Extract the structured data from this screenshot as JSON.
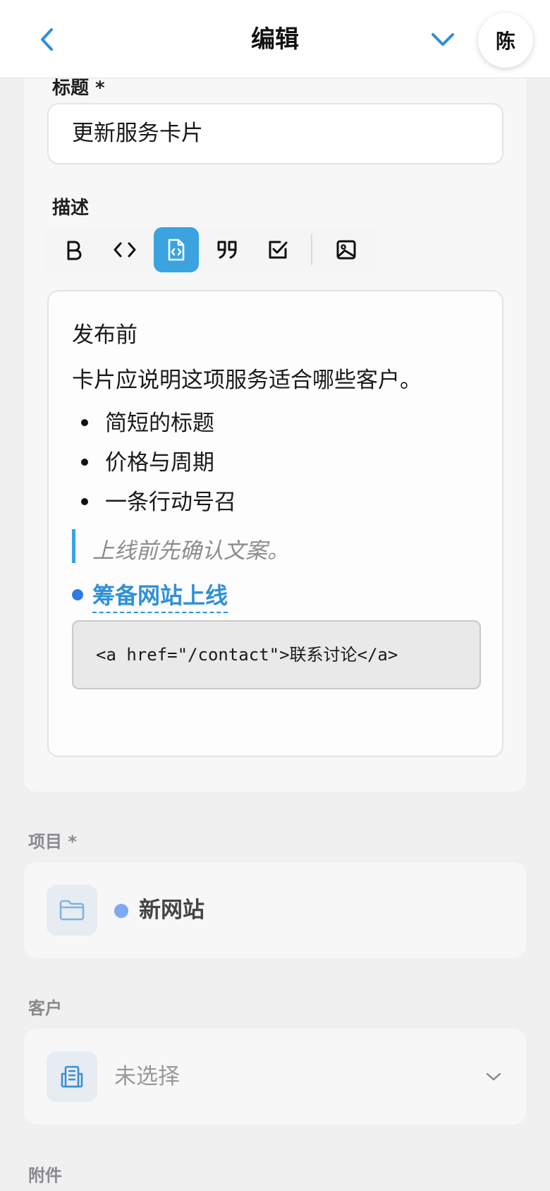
{
  "header": {
    "title": "编辑",
    "avatar_initial": "陈"
  },
  "form": {
    "title_label": "标题 *",
    "title_value": "更新服务卡片",
    "description_label": "描述",
    "toolbar": [
      "bold-icon",
      "code-icon",
      "code-block-icon",
      "quote-icon",
      "checkbox-icon",
      "image-icon"
    ],
    "editor": {
      "heading": "发布前",
      "paragraph": "卡片应说明这项服务适合哪些客户。",
      "bullets": [
        "简短的标题",
        "价格与周期",
        "一条行动号召"
      ],
      "quote": "上线前先确认文案。",
      "task_link": "筹备网站上线",
      "code": "<a href=\"/contact\">联系讨论</a>"
    },
    "project_label": "项目 *",
    "project_value": "新网站",
    "client_label": "客户",
    "client_value": "未选择",
    "attachments_label": "附件"
  },
  "colors": {
    "accent": "#3aa3e0",
    "link": "#2f91d6",
    "project_dot": "#7fa9f0"
  }
}
